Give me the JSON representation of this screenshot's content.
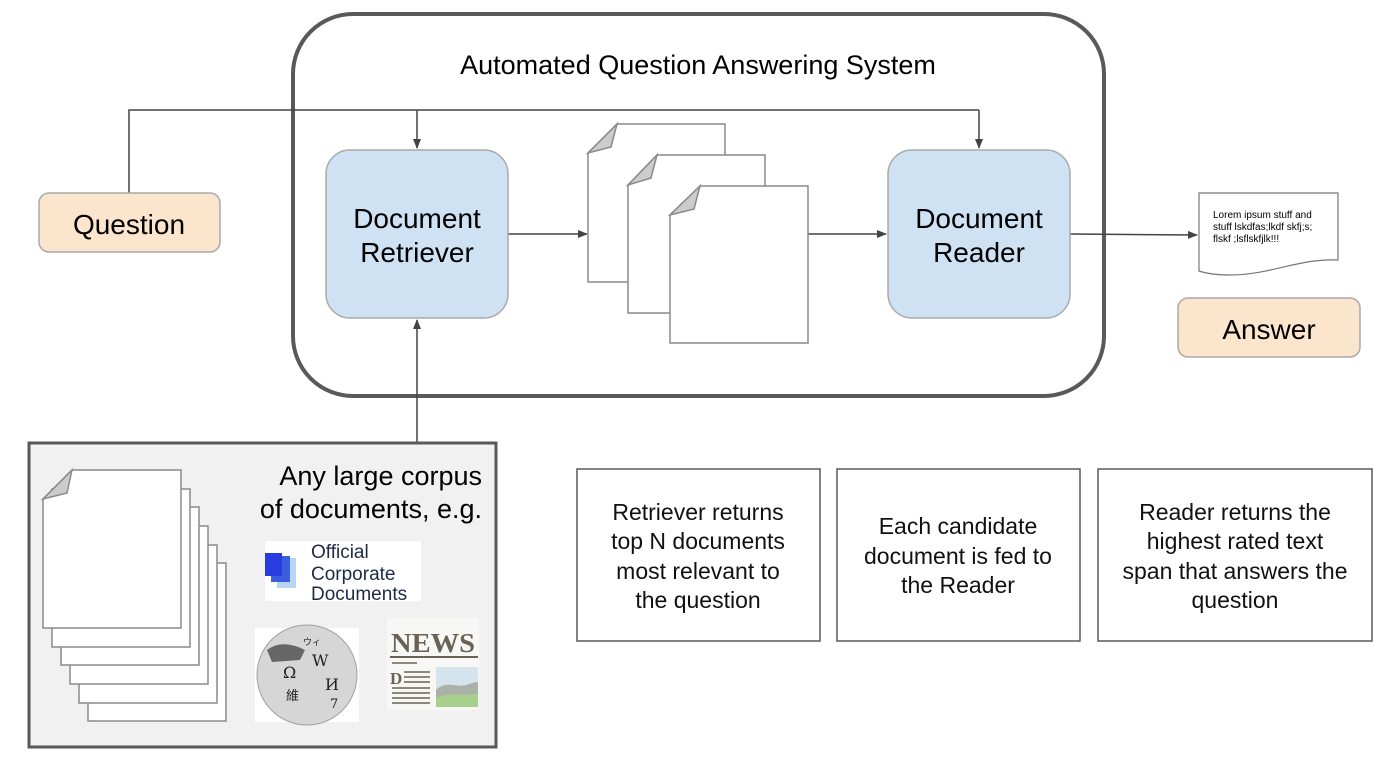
{
  "system": {
    "title": "Automated Question Answering System"
  },
  "nodes": {
    "question": {
      "label": "Question",
      "fill": "#fce5cd"
    },
    "answer": {
      "label": "Answer",
      "fill": "#fce5cd"
    },
    "retriever": {
      "line1": "Document",
      "line2": "Retriever",
      "fill": "#cfe2f3"
    },
    "reader": {
      "line1": "Document",
      "line2": "Reader",
      "fill": "#cfe2f3"
    },
    "answer_doc": {
      "lines": [
        "Lorem ipsum stuff and",
        "stuff lskdfas;lkdf skfj;s;",
        "flskf ;lsflskfjlk!!!"
      ]
    }
  },
  "corpus": {
    "line1": "Any large corpus",
    "line2": "of documents, e.g.",
    "fill": "#f1f1f1",
    "sources": {
      "corporate": {
        "lines": [
          "Official",
          "Corporate",
          "Documents"
        ]
      },
      "wikipedia": {
        "glyphs": [
          "Ω",
          "W",
          "И",
          "維",
          "7",
          "ウィ"
        ]
      },
      "news": {
        "title": "NEWS",
        "dropcap": "D"
      }
    }
  },
  "notes": [
    {
      "lines": [
        "Retriever returns",
        "top N documents",
        "most relevant to",
        "the question"
      ]
    },
    {
      "lines": [
        "Each candidate",
        "document is fed to",
        "the Reader"
      ]
    },
    {
      "lines": [
        "Reader returns the",
        "highest rated text",
        "span that answers the",
        "question"
      ]
    }
  ],
  "colors": {
    "stroke_dark": "#595959",
    "stroke_light": "#999999",
    "connector": "#444444"
  }
}
